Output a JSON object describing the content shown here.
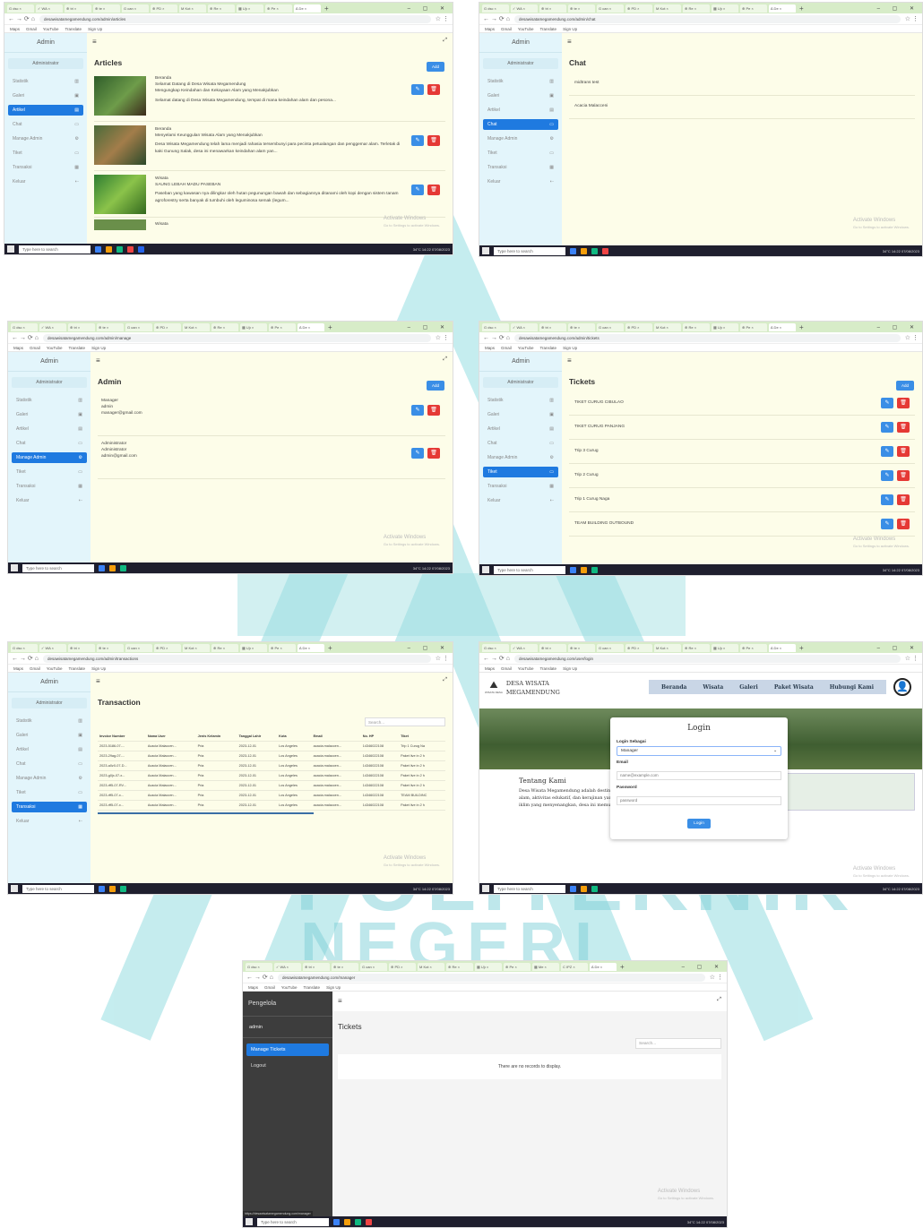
{
  "browser": {
    "tabs": [
      "G dsc ×",
      "✓ WA ×",
      "⊕ tri ×",
      "⊕ te ×",
      "G can ×",
      "⊕ PD ×",
      "M Kot ×",
      "⊕ Re ×",
      "▦ Ujı ×",
      "⊕ Pe ×",
      "▦ Me ×",
      "C IPZ ×",
      "∆ De ×"
    ],
    "bookmarks": [
      "Maps",
      "Gmail",
      "YouTube",
      "Translate",
      "Sign Up"
    ],
    "urls": {
      "articles": "desawisatamegamendung.com/admin/articles",
      "chat": "desawisatamegamendung.com/admin/chat",
      "manage": "desawisatamegamendung.com/admin/manage",
      "tickets": "desawisatamegamendung.com/admin/tickets",
      "transactions": "desawisatamegamendung.com/admin/transactions",
      "login": "desawisatamegamendung.com/user/login",
      "manager": "desawisatamegamendung.com/manager"
    },
    "status_url": "https://desawisatamegamendung.com/manager"
  },
  "taskbar": {
    "search": "Type here to search",
    "weather": "34°C",
    "time": "14:22",
    "date": "07/08/2023"
  },
  "activate": {
    "title": "Activate Windows",
    "sub": "Go to Settings to activate Windows."
  },
  "watermark": {
    "text1": "POLITEKNIK",
    "text2": "NEGERI"
  },
  "admin": {
    "brand": "Admin",
    "role": "Administrator",
    "nav": [
      "Statistik",
      "Galeri",
      "Artikel",
      "Chat",
      "Manage Admin",
      "Tiket",
      "Transaksi",
      "Keluar"
    ],
    "add": "Add"
  },
  "articles": {
    "title": "Articles",
    "items": [
      {
        "category": "Beranda",
        "title": "Selamat Datang di Desa Wisata Megamendung",
        "subtitle": "Mengungkap Keindahan dan Kekayaan Alam yang Menakjubkan",
        "body": "Selamat datang di Desa Wisata Megamendung, tempat di mana keindahan alam dan pesona..."
      },
      {
        "category": "Beranda",
        "title": "Menyelami Keunggulan Wisata Alam yang Menakjubkan",
        "subtitle": "",
        "body": "Desa Wisata Megamendung telah lama menjadi rahasia tersembunyi para pecinta petualangan dan penggemar alam. Terletak di kaki Gunung Salak, desa ini menawarkan keindahan alam yan..."
      },
      {
        "category": "Wisata",
        "title": "SAUNG LEBAH MADU PASEBAN",
        "subtitle": "",
        "body": "Paseban yang kawasan nya dilingkar oleh hutan pegunungan bawah dan sebagiannya ditanami oleh kopi dengan sistem tanam agroforestry serta banyak di tumbuhi oleh leguminosa semak (legum..."
      },
      {
        "category": "Wisata",
        "title": "",
        "subtitle": "",
        "body": ""
      }
    ]
  },
  "chat": {
    "title": "Chat",
    "items": [
      "midtrans test",
      "Acacia Malacceni"
    ]
  },
  "manage": {
    "title": "Admin",
    "users": [
      {
        "role": "Manager",
        "name": "admin",
        "email": "manager@gmail.com"
      },
      {
        "role": "Administrator",
        "name": "Administrator",
        "email": "admin@gmail.com"
      }
    ]
  },
  "tickets": {
    "title": "Tickets",
    "items": [
      "TIKET CURUG CIBULAO",
      "TIKET CURUG PANJANG",
      "Trip 3 Curug",
      "Trip 2 Curug",
      "Trip 1 Curug Naga",
      "TEAM BUILDING OUTBOUND"
    ]
  },
  "transactions": {
    "title": "Transaction",
    "search": "Search...",
    "columns": [
      "Invoice Number",
      "Nama User",
      "Jenis Kelamin",
      "Tanggal Lahir",
      "Kota",
      "Email",
      "No. HP",
      "Tiket"
    ],
    "rows": [
      [
        "2023-5186-07-...",
        "Acacia Malaccen...",
        "Pria",
        "2023-12-01",
        "Los Angeles",
        "acacia.malaccen...",
        "14346022108",
        "Trip 1 Curug Na"
      ],
      [
        "2023-29ag-07-...",
        "Acacia Malaccen...",
        "Pria",
        "2023-12-01",
        "Los Angeles",
        "acacia.malaccen...",
        "14346022108",
        "Paket live in 2 h"
      ],
      [
        "2023-a0z0-07-D...",
        "Acacia Malaccen...",
        "Pria",
        "2023-12-01",
        "Los Angeles",
        "acacia.malaccen...",
        "14346022108",
        "Paket live in 2 h"
      ],
      [
        "2023-g0jx-07-x...",
        "Acacia Malaccen...",
        "Pria",
        "2023-12-01",
        "Los Angeles",
        "acacia.malaccen...",
        "14346022108",
        "Paket live in 2 h"
      ],
      [
        "2023-rff5-07-RV...",
        "Acacia Malaccen...",
        "Pria",
        "2023-12-01",
        "Los Angeles",
        "acacia.malaccen...",
        "14346022108",
        "Paket live in 2 h"
      ],
      [
        "2023-rff5-07-x...",
        "Acacia Malaccen...",
        "Pria",
        "2023-12-01",
        "Los Angeles",
        "acacia.malaccen...",
        "14346022108",
        "TEAM BUILDINC"
      ],
      [
        "2023-rff5-07-x...",
        "Acacia Malaccen...",
        "Pria",
        "2023-12-01",
        "Los Angeles",
        "acacia.malaccen...",
        "14346022108",
        "Paket live in 2 h"
      ]
    ]
  },
  "login": {
    "brand1": "DESA WISATA",
    "brand2": "MEGAMENDUNG",
    "logo_sub": "WISATA DESA",
    "nav": [
      "Beranda",
      "Wisata",
      "Galeri",
      "Paket Wisata",
      "Hubungi Kami"
    ],
    "form_title": "Login",
    "role_label": "Login Sebagai",
    "role_value": "Manager",
    "email_label": "Email",
    "email_ph": "name@example.com",
    "password_label": "Password",
    "password_ph": "password",
    "button": "Login",
    "about_title": "Tentang Kami",
    "about_text": "Desa Wisata Megamendung adalah destinasi wisata yang menawarkan keindahan alam, aktivitas edukatif, dan kerajinan yang unik. Dengan panorama indah dan iklim yang menyenangkan, desa ini memukau"
  },
  "manager": {
    "brand": "Pengelola",
    "user": "admin",
    "nav": [
      "Manage Tickets",
      "Logout"
    ],
    "title": "Tickets",
    "search": "Search...",
    "empty": "There are no records to display."
  }
}
